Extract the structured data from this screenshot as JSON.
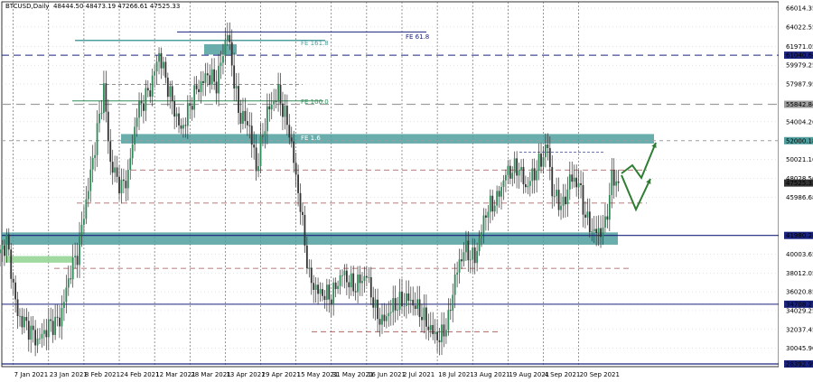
{
  "header": {
    "symbol": "BTCUSD,Daily",
    "ohlc": "48444.50 48473.19 47266.61 47525.33"
  },
  "colors": {
    "bull": "#2e8b57",
    "bear": "#333333",
    "zone": "#4f9f9f",
    "zone_green": "#8fd48f",
    "blue_line": "#1a237e",
    "red_dash": "#a05050",
    "grey_dash": "#9e9e9e",
    "arrow": "#2e7d32"
  },
  "fib_labels": {
    "fe618": "FE 61.8",
    "fe1618": "FE 161.8",
    "fe100": "FE 100.0",
    "fe_other": "FE 1.6"
  },
  "chart_data": {
    "type": "candlestick",
    "title": "BTCUSD,Daily",
    "ylim": [
      28392.99,
      66014.35
    ],
    "y_ticks": [
      {
        "label": "66014.35",
        "value": 66014.35
      },
      {
        "label": "64022.55",
        "value": 64022.55
      },
      {
        "label": "61971.05",
        "value": 61971.05
      },
      {
        "label": "59979.25",
        "value": 59979.25
      },
      {
        "label": "57987.95",
        "value": 57987.95
      },
      {
        "label": "54004.26",
        "value": 54004.26
      },
      {
        "label": "50021.16",
        "value": 50021.16
      },
      {
        "label": "48028.56",
        "value": 48028.56
      },
      {
        "label": "45986.68",
        "value": 45986.68
      },
      {
        "label": "40003.65",
        "value": 40003.65
      },
      {
        "label": "38012.05",
        "value": 38012.05
      },
      {
        "label": "36020.85",
        "value": 36020.85
      },
      {
        "label": "34029.25",
        "value": 34029.25
      },
      {
        "label": "32037.45",
        "value": 32037.45
      },
      {
        "label": "30045.90",
        "value": 30045.9
      }
    ],
    "price_labels": [
      {
        "label": "61040.64",
        "value": 61040.64,
        "color": "#1a237e"
      },
      {
        "label": "55842.84",
        "value": 55842.84,
        "color": "#9e9e9e"
      },
      {
        "label": "52000.18",
        "value": 52000.18,
        "color": "#4f9f9f"
      },
      {
        "label": "47525.33",
        "value": 47525.33,
        "color": "#333333"
      },
      {
        "label": "41980.24",
        "value": 41980.24,
        "color": "#1a237e"
      },
      {
        "label": "34708.27",
        "value": 34708.27,
        "color": "#1a237e"
      },
      {
        "label": "28392.99",
        "value": 28392.99,
        "color": "#1a237e"
      }
    ],
    "x_ticks": [
      "7 Jan 2021",
      "23 Jan 2021",
      "8 Feb 2021",
      "24 Feb 2021",
      "12 Mar 2021",
      "28 Mar 2021",
      "13 Apr 2021",
      "29 Apr 2021",
      "15 May 2021",
      "31 May 2021",
      "16 Jun 2021",
      "2 Jul 2021",
      "18 Jul 2021",
      "3 Aug 2021",
      "19 Aug 2021",
      "4 Sep 2021",
      "20 Sep 2021"
    ],
    "x_tick_days": [
      6,
      22,
      38,
      54,
      70,
      86,
      102,
      118,
      134,
      150,
      166,
      182,
      198,
      214,
      230,
      246,
      262
    ],
    "last_price": 47525.33,
    "key_points": [
      {
        "day": 0,
        "price": 40000
      },
      {
        "day": 3,
        "price": 41500
      },
      {
        "day": 8,
        "price": 33500
      },
      {
        "day": 12,
        "price": 32500
      },
      {
        "day": 17,
        "price": 30800
      },
      {
        "day": 22,
        "price": 32400
      },
      {
        "day": 27,
        "price": 33000
      },
      {
        "day": 32,
        "price": 38300
      },
      {
        "day": 35,
        "price": 40000
      },
      {
        "day": 40,
        "price": 47000
      },
      {
        "day": 47,
        "price": 57500
      },
      {
        "day": 50,
        "price": 49600
      },
      {
        "day": 55,
        "price": 47000
      },
      {
        "day": 58,
        "price": 48400
      },
      {
        "day": 62,
        "price": 55000
      },
      {
        "day": 68,
        "price": 57500
      },
      {
        "day": 72,
        "price": 61200
      },
      {
        "day": 78,
        "price": 56000
      },
      {
        "day": 82,
        "price": 53000
      },
      {
        "day": 88,
        "price": 57000
      },
      {
        "day": 94,
        "price": 59000
      },
      {
        "day": 98,
        "price": 58000
      },
      {
        "day": 103,
        "price": 63500
      },
      {
        "day": 108,
        "price": 55000
      },
      {
        "day": 113,
        "price": 53500
      },
      {
        "day": 116,
        "price": 49000
      },
      {
        "day": 121,
        "price": 55000
      },
      {
        "day": 126,
        "price": 57000
      },
      {
        "day": 131,
        "price": 53000
      },
      {
        "day": 136,
        "price": 45000
      },
      {
        "day": 140,
        "price": 37500
      },
      {
        "day": 144,
        "price": 36000
      },
      {
        "day": 150,
        "price": 35500
      },
      {
        "day": 155,
        "price": 38000
      },
      {
        "day": 160,
        "price": 36500
      },
      {
        "day": 166,
        "price": 37800
      },
      {
        "day": 170,
        "price": 34000
      },
      {
        "day": 173,
        "price": 32800
      },
      {
        "day": 178,
        "price": 34500
      },
      {
        "day": 185,
        "price": 35300
      },
      {
        "day": 190,
        "price": 34000
      },
      {
        "day": 195,
        "price": 32000
      },
      {
        "day": 199,
        "price": 31000
      },
      {
        "day": 203,
        "price": 33000
      },
      {
        "day": 206,
        "price": 37500
      },
      {
        "day": 210,
        "price": 40500
      },
      {
        "day": 215,
        "price": 39500
      },
      {
        "day": 220,
        "price": 44500
      },
      {
        "day": 225,
        "price": 45800
      },
      {
        "day": 229,
        "price": 48500
      },
      {
        "day": 235,
        "price": 49200
      },
      {
        "day": 238,
        "price": 47000
      },
      {
        "day": 244,
        "price": 49500
      },
      {
        "day": 248,
        "price": 51500
      },
      {
        "day": 250,
        "price": 46500
      },
      {
        "day": 255,
        "price": 45000
      },
      {
        "day": 258,
        "price": 48000
      },
      {
        "day": 262,
        "price": 47500
      },
      {
        "day": 265,
        "price": 44000
      },
      {
        "day": 268,
        "price": 42500
      },
      {
        "day": 271,
        "price": 42300
      },
      {
        "day": 274,
        "price": 43000
      },
      {
        "day": 277,
        "price": 48000
      },
      {
        "day": 280,
        "price": 47525
      }
    ]
  }
}
